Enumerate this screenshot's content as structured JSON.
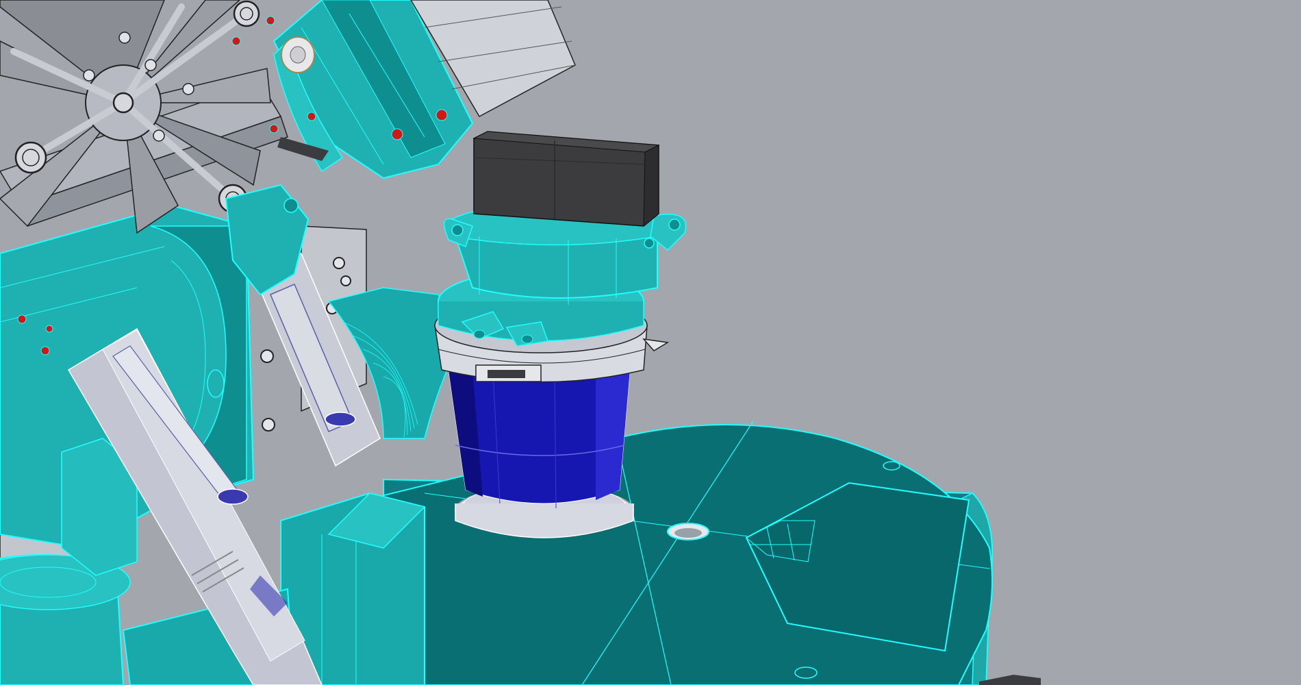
{
  "viewport": {
    "view_mode": "shaded-with-edges",
    "colors": {
      "background": "#a3a7ad",
      "assembly_teal": "#0a6f73",
      "assembly_teal_light": "#28b8b8",
      "edge_cyan": "#20ffff",
      "metal_gray": "#b8bcc6",
      "metal_light": "#d8dbe3",
      "bucket_blue": "#1a1ab8",
      "bucket_blue_dark": "#0c0c7a",
      "sensor_dark": "#3c3c3e",
      "bolt_red": "#d01818"
    },
    "icons": [
      "radial-fan-heatsink-icon",
      "clamp-bracket-icon",
      "blue-container-icon",
      "dark-sensor-box-icon",
      "turntable-base-icon",
      "support-tube-icon"
    ]
  }
}
